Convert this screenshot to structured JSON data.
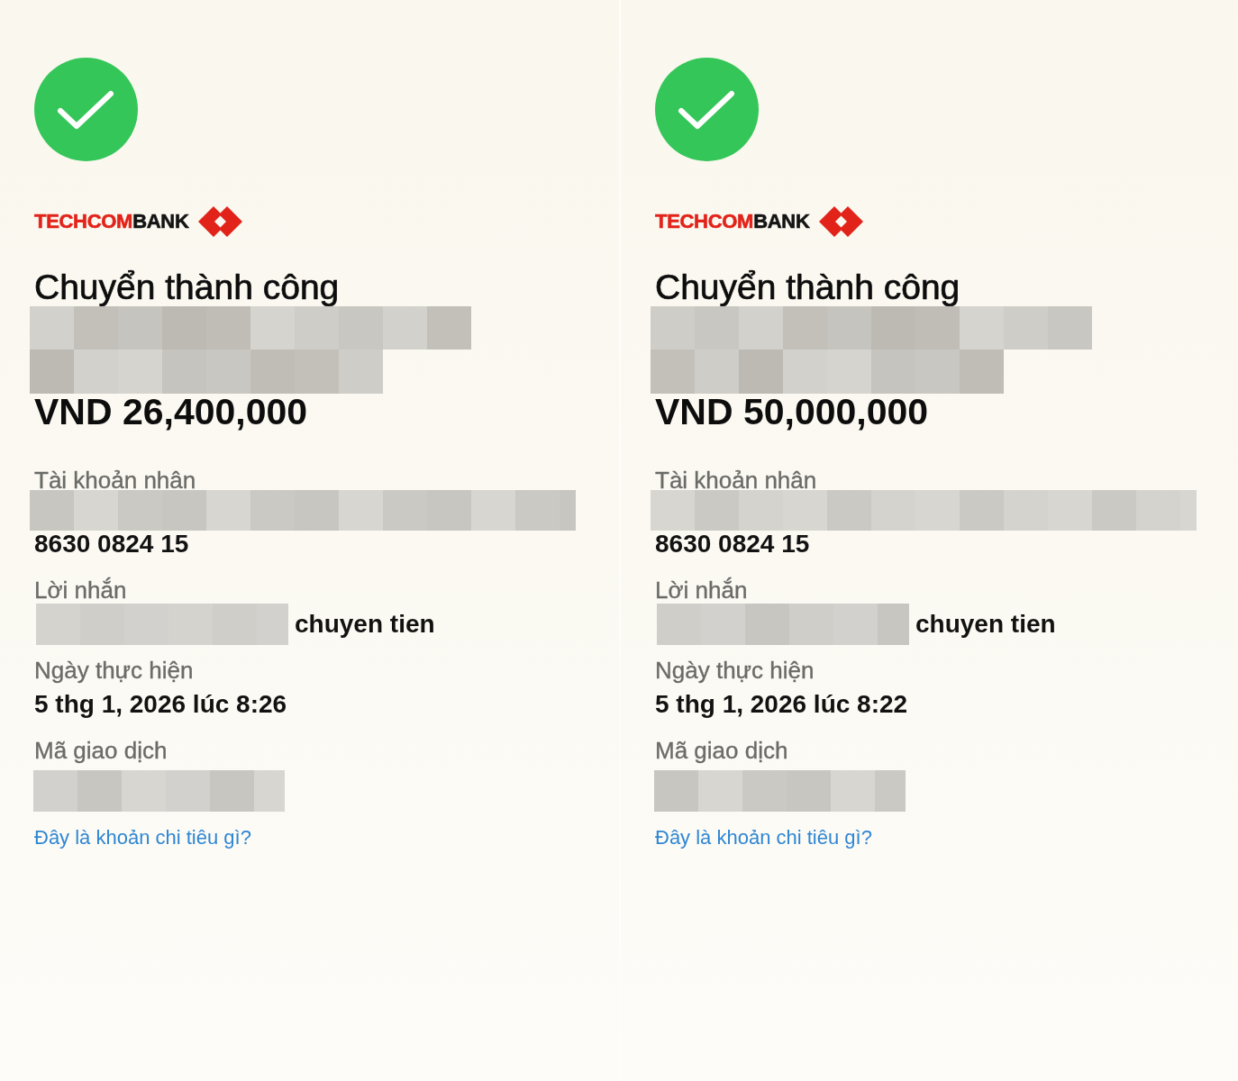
{
  "receipts": [
    {
      "success": true,
      "logo": {
        "first_part": "TECHCOM",
        "second_part": "BANK"
      },
      "title": "Chuyển thành công",
      "recipient_pixelated": true,
      "amount": "VND 26,400,000",
      "account": {
        "label": "Tài khoản nhân",
        "name_pixelated": true,
        "number": "8630 0824 15"
      },
      "message": {
        "label": "Lời nhắn",
        "start_pixelated": true,
        "text": "chuyen tien"
      },
      "date": {
        "label": "Ngày thực hiện",
        "value": "5 thg 1, 2026 lúc 8:26"
      },
      "transaction_code": {
        "label": "Mã giao dịch",
        "pixelated": true
      },
      "link": "Đây là khoản chi tiêu gì?"
    },
    {
      "success": true,
      "logo": {
        "first_part": "TECHCOM",
        "second_part": "BANK"
      },
      "title": "Chuyển thành công",
      "recipient_pixelated": true,
      "amount": "VND 50,000,000",
      "account": {
        "label": "Tài khoản nhân",
        "name_pixelated": true,
        "number": "8630 0824 15"
      },
      "message": {
        "label": "Lời nhắn",
        "start_pixelated": true,
        "text": "chuyen tien"
      },
      "date": {
        "label": "Ngày thực hiện",
        "value": "5 thg 1, 2026 lúc 8:22"
      },
      "transaction_code": {
        "label": "Mã giao dịch",
        "pixelated": true
      },
      "link": "Đây là khoản chi tiêu gì?"
    }
  ]
}
